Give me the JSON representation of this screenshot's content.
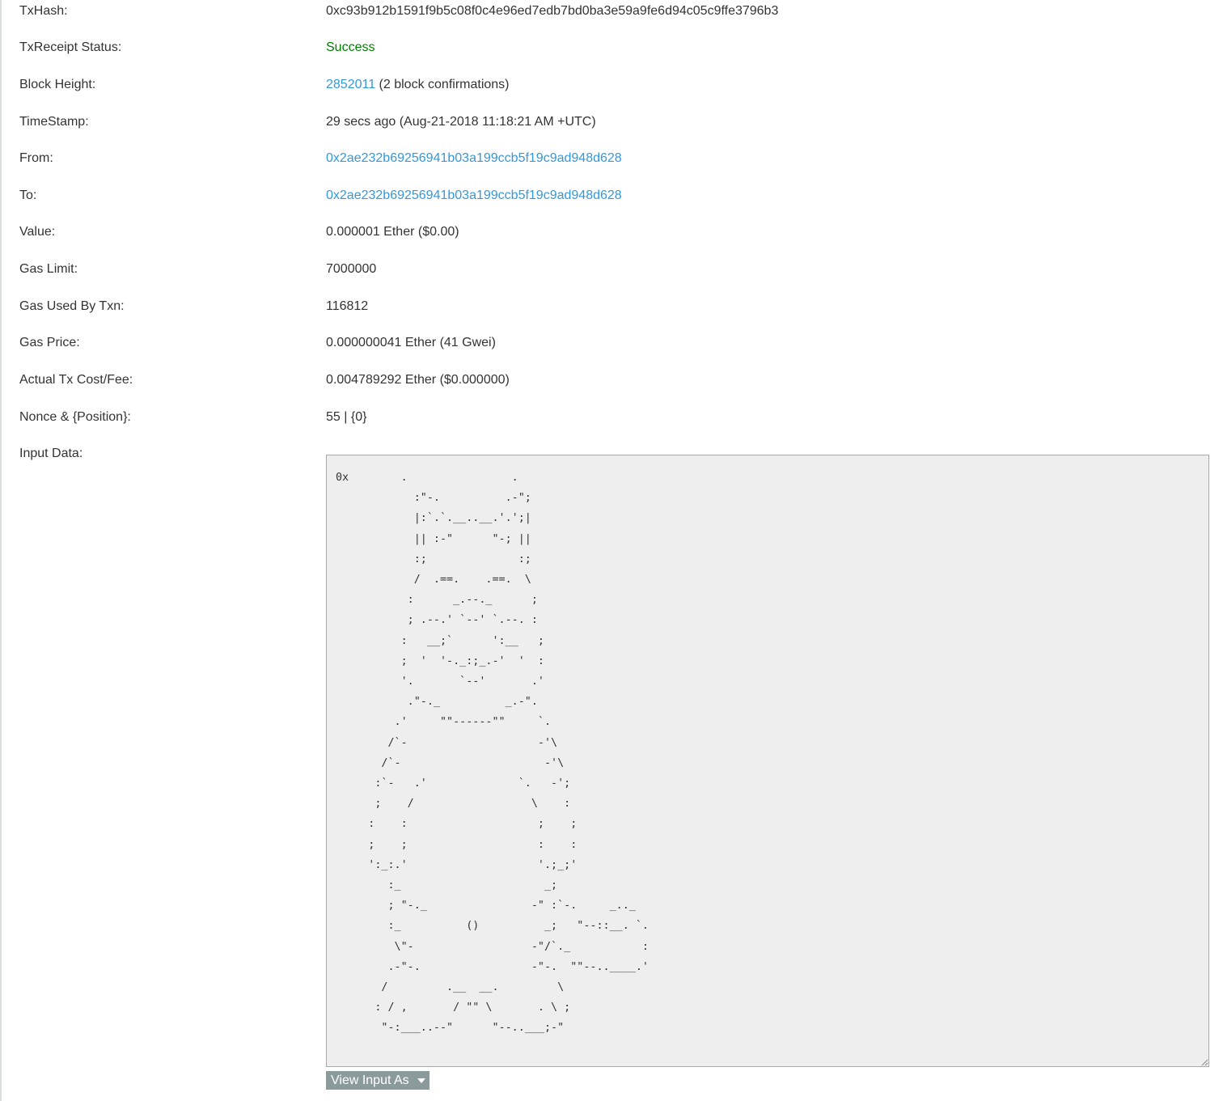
{
  "rows": [
    {
      "label": "TxHash:",
      "value": "0xc93b912b1591f9b5c08f0c4e96ed7edb7bd0ba3e59a9fe6d94c05c9ffe3796b3"
    },
    {
      "label": "TxReceipt Status:",
      "value": "Success"
    },
    {
      "label": "Block Height:",
      "link": "2852011",
      "suffix": " (2 block confirmations)"
    },
    {
      "label": "TimeStamp:",
      "value": "29 secs ago (Aug-21-2018 11:18:21 AM +UTC)"
    },
    {
      "label": "From:",
      "value": "0x2ae232b69256941b03a199ccb5f19c9ad948d628"
    },
    {
      "label": "To:",
      "value": "0x2ae232b69256941b03a199ccb5f19c9ad948d628"
    },
    {
      "label": "Value:",
      "value": "0.000001 Ether ($0.00)"
    },
    {
      "label": "Gas Limit:",
      "value": "7000000"
    },
    {
      "label": "Gas Used By Txn:",
      "value": "116812"
    },
    {
      "label": "Gas Price:",
      "value": "0.000000041 Ether (41 Gwei)"
    },
    {
      "label": "Actual Tx Cost/Fee:",
      "value": "0.004789292 Ether ($0.000000)"
    },
    {
      "label": "Nonce & {Position}:",
      "value": "55 | {0}"
    },
    {
      "label": "Input Data:"
    }
  ],
  "input_data": "0x        .                .\n            :\"-.          .-\";\n            |:`.`.__..__.'.';|\n            || :-\"      \"-; ||\n            :;              :;\n            /  .==.    .==.  \\\n           :      _.--._      ;\n           ; .--.' `--' `.--. :\n          :   __;`      ':__   ;\n          ;  '  '-._:;_.-'  '  :\n          '.       `--'       .'\n           .\"-._          _.-\".\n         .'     \"\"------\"\"     `.\n        /`-                    -'\\\n       /`-                      -'\\\n      :`-   .'              `.   -';\n      ;    /                  \\    :\n     :    :                    ;    ;\n     ;    ;                    :    :\n     ':_:.'                    '.;_;'\n        :_                      _;\n        ; \"-._                -\" :`-.     _.._\n        :_          ()          _;   \"--::__. `.\n         \\\"-                  -\"/`._           :\n        .-\"-.                 -\"-.  \"\"--..____.'\n       /         .__  __.         \\\n      : / ,       / \"\" \\       . \\ ;\n       \"-:___..--\"      \"--..___;-\"",
  "view_input_button": "View Input As",
  "colors": {
    "link": "#3498db",
    "success": "#008000",
    "text": "#333333",
    "textarea_bg": "#eeeeee",
    "button_bg": "#8b9a9b"
  }
}
